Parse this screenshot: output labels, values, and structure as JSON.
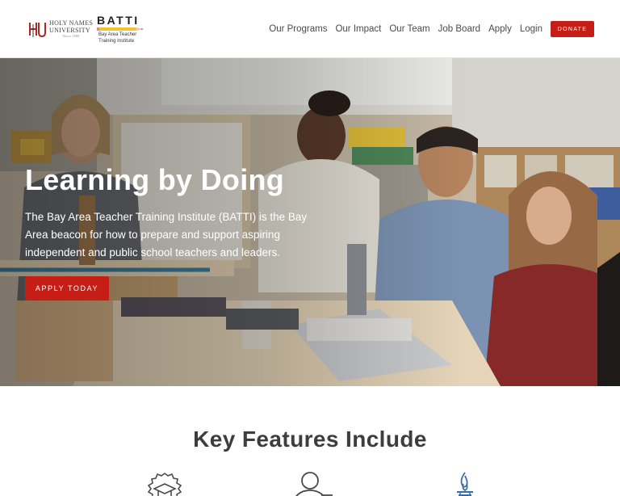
{
  "header": {
    "hnu_logo": {
      "line1": "HOLY NAMES",
      "line2": "UNIVERSITY",
      "since": "Since 1868"
    },
    "batti_logo": {
      "word": "BATTI",
      "sub1": "Bay Area Teacher",
      "sub2": "Training Institute"
    },
    "nav": [
      {
        "label": "Our Programs"
      },
      {
        "label": "Our Impact"
      },
      {
        "label": "Our Team"
      },
      {
        "label": "Job Board"
      },
      {
        "label": "Apply"
      },
      {
        "label": "Login"
      }
    ],
    "donate_label": "DONATE"
  },
  "hero": {
    "title": "Learning by Doing",
    "body": "The Bay Area Teacher Training Institute (BATTI) is the Bay Area beacon for how to prepare and support aspiring independent and public school teachers and leaders.",
    "cta_label": "APPLY TODAY"
  },
  "features": {
    "title": "Key Features Include",
    "icons": [
      "graduation-badge-icon",
      "person-icon",
      "flame-icon"
    ]
  },
  "colors": {
    "accent": "#c41e16",
    "nav_text": "#4a4a4a",
    "heading": "#3d3d3d"
  }
}
